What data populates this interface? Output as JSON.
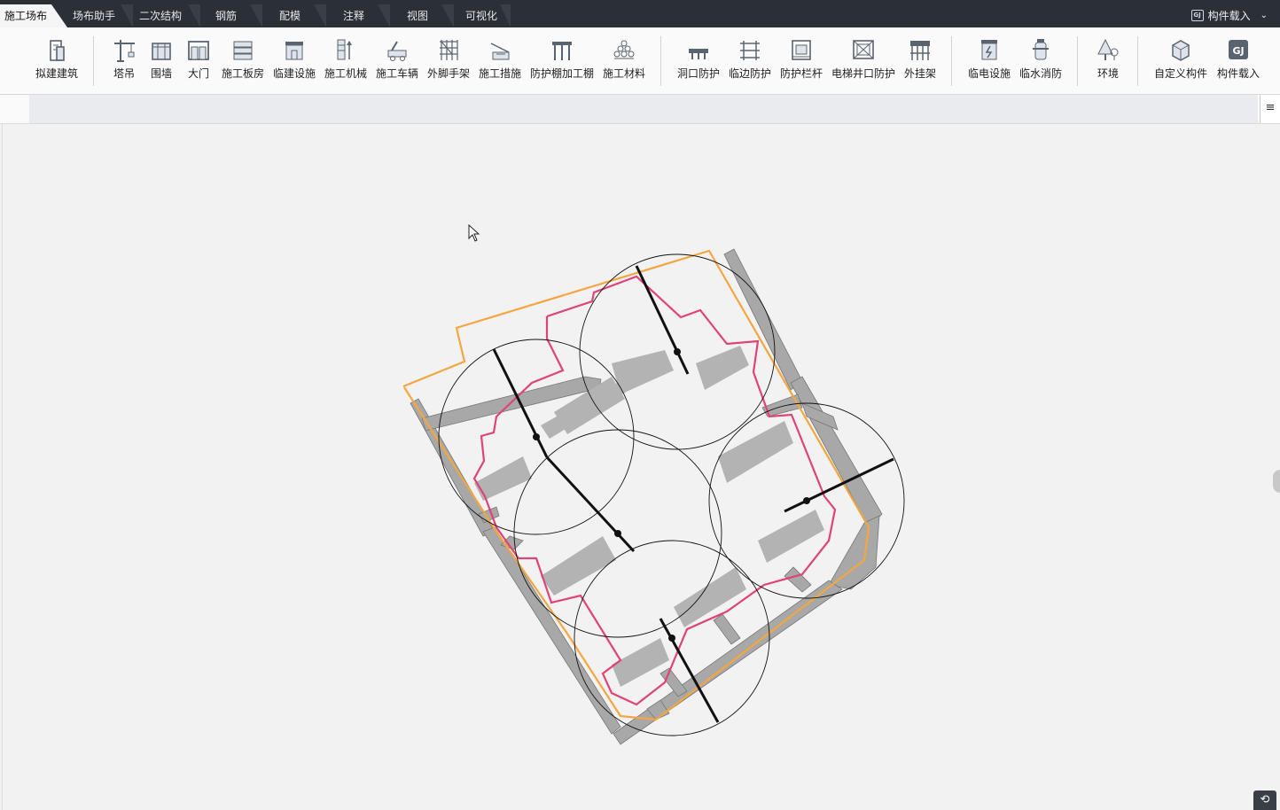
{
  "tabs": [
    {
      "label": "施工场布",
      "active": true
    },
    {
      "label": "场布助手"
    },
    {
      "label": "二次结构"
    },
    {
      "label": "钢筋"
    },
    {
      "label": "配模"
    },
    {
      "label": "注释"
    },
    {
      "label": "视图"
    },
    {
      "label": "可视化"
    }
  ],
  "top_right": {
    "label": "构件载入",
    "icon": "gj-icon"
  },
  "ribbon": {
    "items": [
      {
        "label": "拟建建筑",
        "icon": "building-icon"
      },
      {
        "label": "塔吊",
        "icon": "tower-crane-icon"
      },
      {
        "label": "围墙",
        "icon": "wall-icon"
      },
      {
        "label": "大门",
        "icon": "gate-icon"
      },
      {
        "label": "施工板房",
        "icon": "board-house-icon"
      },
      {
        "label": "临建设施",
        "icon": "temp-facility-icon"
      },
      {
        "label": "施工机械",
        "icon": "machinery-icon"
      },
      {
        "label": "施工车辆",
        "icon": "vehicle-icon"
      },
      {
        "label": "外脚手架",
        "icon": "scaffold-icon"
      },
      {
        "label": "施工措施",
        "icon": "measure-icon"
      },
      {
        "label": "防护棚加工棚",
        "icon": "shed-icon"
      },
      {
        "label": "施工材料",
        "icon": "material-icon"
      },
      {
        "label": "洞口防护",
        "icon": "opening-guard-icon"
      },
      {
        "label": "临边防护",
        "icon": "edge-guard-icon"
      },
      {
        "label": "防护栏杆",
        "icon": "railing-icon"
      },
      {
        "label": "电梯井口防护",
        "icon": "elevator-guard-icon"
      },
      {
        "label": "外挂架",
        "icon": "hanging-frame-icon"
      },
      {
        "label": "临电设施",
        "icon": "power-icon"
      },
      {
        "label": "临水消防",
        "icon": "hydrant-icon"
      },
      {
        "label": "环境",
        "icon": "tree-icon"
      },
      {
        "label": "自定义构件",
        "icon": "custom-part-icon"
      },
      {
        "label": "构件载入",
        "icon": "part-load-icon"
      }
    ]
  },
  "strip": {
    "menu_icon": "≡"
  },
  "colors": {
    "orange_boundary": "#f4a640",
    "pink_boundary": "#e0427a",
    "road": "#a8a8a8",
    "tab_bar": "#2b2f36"
  }
}
